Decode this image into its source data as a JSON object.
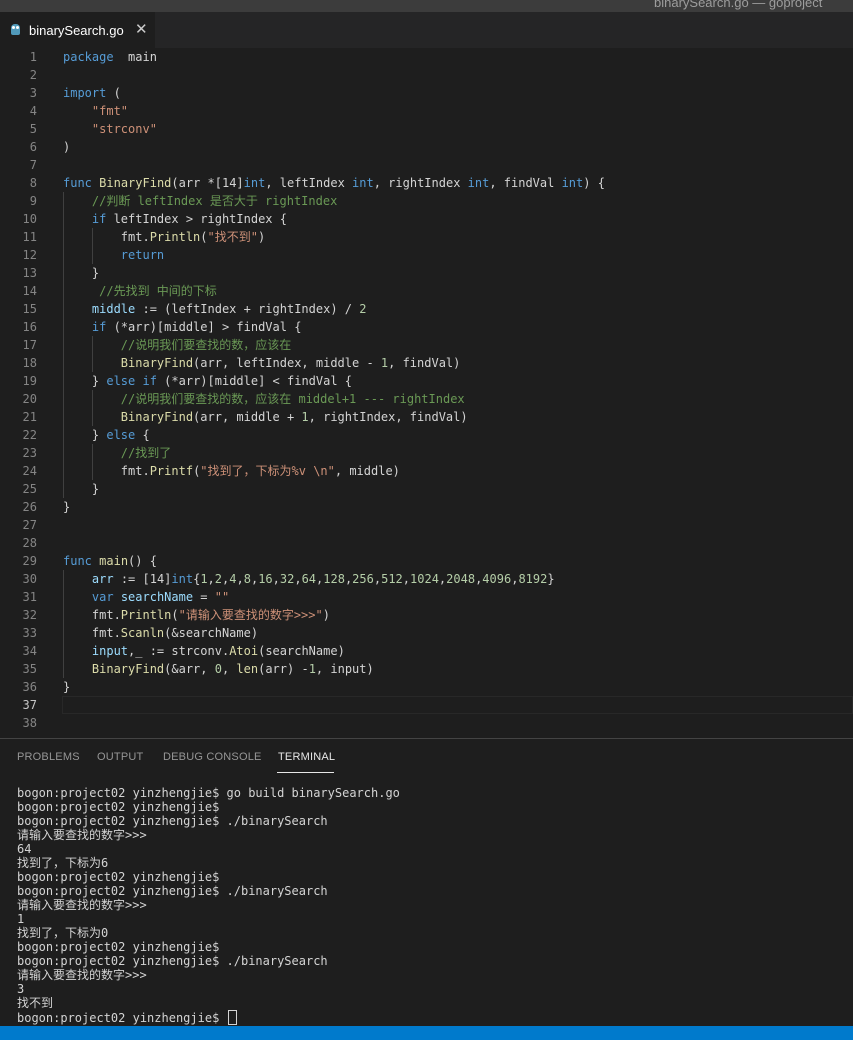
{
  "window": {
    "title": "binarySearch.go — goproject"
  },
  "tab": {
    "label": "binarySearch.go",
    "close": "✕",
    "icon": "go-file-icon"
  },
  "editor": {
    "active_line": 37,
    "lines": [
      [
        [
          "kw",
          "package"
        ],
        [
          "",
          "  main"
        ]
      ],
      [],
      [
        [
          "kw",
          "import"
        ],
        [
          "",
          " ("
        ]
      ],
      [
        [
          "",
          "    "
        ],
        [
          "str",
          "\"fmt\""
        ]
      ],
      [
        [
          "",
          "    "
        ],
        [
          "str",
          "\"strconv\""
        ]
      ],
      [
        [
          "",
          ")"
        ]
      ],
      [],
      [
        [
          "kw",
          "func"
        ],
        [
          "",
          " "
        ],
        [
          "fn",
          "BinaryFind"
        ],
        [
          "",
          "(arr *[14]"
        ],
        [
          "kw",
          "int"
        ],
        [
          "",
          ", leftIndex "
        ],
        [
          "kw",
          "int"
        ],
        [
          "",
          ", rightIndex "
        ],
        [
          "kw",
          "int"
        ],
        [
          "",
          ", findVal "
        ],
        [
          "kw",
          "int"
        ],
        [
          "",
          ") {"
        ]
      ],
      [
        [
          "",
          "    "
        ],
        [
          "cm",
          "//判断 leftIndex 是否大于 rightIndex"
        ]
      ],
      [
        [
          "",
          "    "
        ],
        [
          "kw",
          "if"
        ],
        [
          "",
          " leftIndex > rightIndex {"
        ]
      ],
      [
        [
          "",
          "        fmt."
        ],
        [
          "fn",
          "Println"
        ],
        [
          "",
          "("
        ],
        [
          "str",
          "\"找不到\""
        ],
        [
          "",
          ")"
        ]
      ],
      [
        [
          "",
          "        "
        ],
        [
          "kw",
          "return"
        ]
      ],
      [
        [
          "",
          "    }"
        ]
      ],
      [
        [
          "",
          "     "
        ],
        [
          "cm",
          "//先找到 中间的下标"
        ]
      ],
      [
        [
          "",
          "    "
        ],
        [
          "var",
          "middle"
        ],
        [
          "",
          " := (leftIndex + rightIndex) / "
        ],
        [
          "num",
          "2"
        ]
      ],
      [
        [
          "",
          "    "
        ],
        [
          "kw",
          "if"
        ],
        [
          "",
          " (*arr)[middle] > findVal {"
        ]
      ],
      [
        [
          "",
          "        "
        ],
        [
          "cm",
          "//说明我们要查找的数，应该在"
        ]
      ],
      [
        [
          "",
          "        "
        ],
        [
          "fn",
          "BinaryFind"
        ],
        [
          "",
          "(arr, leftIndex, middle - "
        ],
        [
          "num",
          "1"
        ],
        [
          "",
          ", findVal)"
        ]
      ],
      [
        [
          "",
          "    } "
        ],
        [
          "kw",
          "else"
        ],
        [
          "",
          " "
        ],
        [
          "kw",
          "if"
        ],
        [
          "",
          " (*arr)[middle] < findVal {"
        ]
      ],
      [
        [
          "",
          "        "
        ],
        [
          "cm",
          "//说明我们要查找的数，应该在 middel+1 --- rightIndex"
        ]
      ],
      [
        [
          "",
          "        "
        ],
        [
          "fn",
          "BinaryFind"
        ],
        [
          "",
          "(arr, middle + "
        ],
        [
          "num",
          "1"
        ],
        [
          "",
          ", rightIndex, findVal)"
        ]
      ],
      [
        [
          "",
          "    } "
        ],
        [
          "kw",
          "else"
        ],
        [
          "",
          " {"
        ]
      ],
      [
        [
          "",
          "        "
        ],
        [
          "cm",
          "//找到了"
        ]
      ],
      [
        [
          "",
          "        fmt."
        ],
        [
          "fn",
          "Printf"
        ],
        [
          "",
          "("
        ],
        [
          "str",
          "\"找到了，下标为%v \\n\""
        ],
        [
          "",
          ", middle)"
        ]
      ],
      [
        [
          "",
          "    }"
        ]
      ],
      [
        [
          "",
          "}"
        ]
      ],
      [],
      [],
      [
        [
          "kw",
          "func"
        ],
        [
          "",
          " "
        ],
        [
          "fn",
          "main"
        ],
        [
          "",
          "() {"
        ]
      ],
      [
        [
          "",
          "    "
        ],
        [
          "var",
          "arr"
        ],
        [
          "",
          " := [14]"
        ],
        [
          "kw",
          "int"
        ],
        [
          "",
          "{"
        ],
        [
          "num",
          "1"
        ],
        [
          "",
          ","
        ],
        [
          "num",
          "2"
        ],
        [
          "",
          ","
        ],
        [
          "num",
          "4"
        ],
        [
          "",
          ","
        ],
        [
          "num",
          "8"
        ],
        [
          "",
          ","
        ],
        [
          "num",
          "16"
        ],
        [
          "",
          ","
        ],
        [
          "num",
          "32"
        ],
        [
          "",
          ","
        ],
        [
          "num",
          "64"
        ],
        [
          "",
          ","
        ],
        [
          "num",
          "128"
        ],
        [
          "",
          ","
        ],
        [
          "num",
          "256"
        ],
        [
          "",
          ","
        ],
        [
          "num",
          "512"
        ],
        [
          "",
          ","
        ],
        [
          "num",
          "1024"
        ],
        [
          "",
          ","
        ],
        [
          "num",
          "2048"
        ],
        [
          "",
          ","
        ],
        [
          "num",
          "4096"
        ],
        [
          "",
          ","
        ],
        [
          "num",
          "8192"
        ],
        [
          "",
          "}"
        ]
      ],
      [
        [
          "",
          "    "
        ],
        [
          "kw",
          "var"
        ],
        [
          "",
          " "
        ],
        [
          "var",
          "searchName"
        ],
        [
          "",
          " = "
        ],
        [
          "str",
          "\"\""
        ]
      ],
      [
        [
          "",
          "    fmt."
        ],
        [
          "fn",
          "Println"
        ],
        [
          "",
          "("
        ],
        [
          "str",
          "\"请输入要查找的数字>>>\""
        ],
        [
          "",
          ")"
        ]
      ],
      [
        [
          "",
          "    fmt."
        ],
        [
          "fn",
          "Scanln"
        ],
        [
          "",
          "(&searchName)"
        ]
      ],
      [
        [
          "",
          "    "
        ],
        [
          "var",
          "input"
        ],
        [
          "",
          ",_ := strconv."
        ],
        [
          "fn",
          "Atoi"
        ],
        [
          "",
          "(searchName)"
        ]
      ],
      [
        [
          "",
          "    "
        ],
        [
          "fn",
          "BinaryFind"
        ],
        [
          "",
          "(&arr, "
        ],
        [
          "num",
          "0"
        ],
        [
          "",
          ", "
        ],
        [
          "fn",
          "len"
        ],
        [
          "",
          "(arr) -"
        ],
        [
          "num",
          "1"
        ],
        [
          "",
          ", input)"
        ]
      ],
      [
        [
          "",
          "}"
        ]
      ],
      [],
      []
    ]
  },
  "panel": {
    "tabs": [
      "PROBLEMS",
      "OUTPUT",
      "DEBUG CONSOLE",
      "TERMINAL"
    ],
    "active_tab": "TERMINAL",
    "terminal_lines": [
      "bogon:project02 yinzhengjie$ go build binarySearch.go",
      "bogon:project02 yinzhengjie$",
      "bogon:project02 yinzhengjie$ ./binarySearch",
      "请输入要查找的数字>>>",
      "64",
      "找到了，下标为6",
      "bogon:project02 yinzhengjie$",
      "bogon:project02 yinzhengjie$ ./binarySearch",
      "请输入要查找的数字>>>",
      "1",
      "找到了，下标为0",
      "bogon:project02 yinzhengjie$",
      "bogon:project02 yinzhengjie$ ./binarySearch",
      "请输入要查找的数字>>>",
      "3",
      "找不到",
      "bogon:project02 yinzhengjie$ "
    ]
  },
  "colors": {
    "kw": "#569cd6",
    "fn": "#dcdcaa",
    "str": "#ce9178",
    "cm": "#6a9955",
    "num": "#b5cea8",
    "var": "#9cdcfe",
    "plain": "#d4d4d4",
    "status_bar": "#007acc"
  }
}
